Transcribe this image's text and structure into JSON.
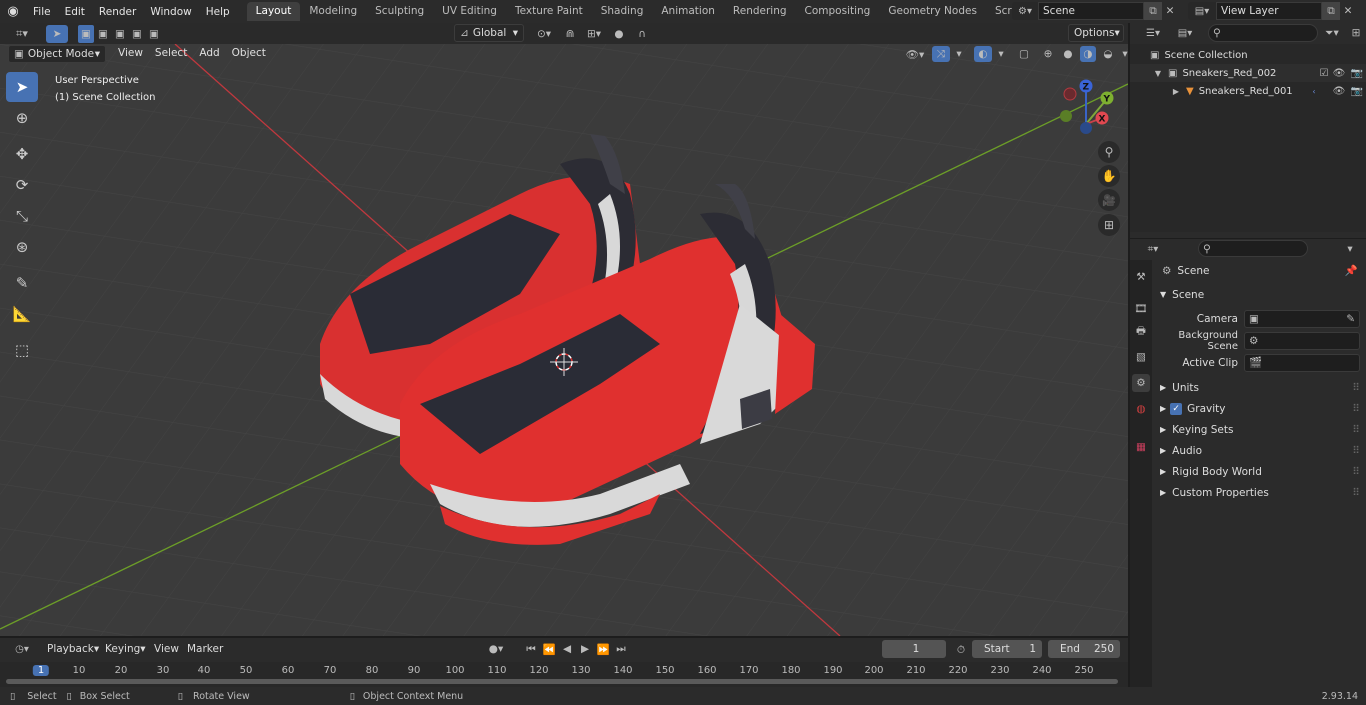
{
  "menu": [
    "File",
    "Edit",
    "Render",
    "Window",
    "Help"
  ],
  "workspaces": [
    "Layout",
    "Modeling",
    "Sculpting",
    "UV Editing",
    "Texture Paint",
    "Shading",
    "Animation",
    "Rendering",
    "Compositing",
    "Geometry Nodes",
    "Scripting"
  ],
  "scene_name": "Scene",
  "view_layer": "View Layer",
  "viewport_header": {
    "mode": "Object Mode",
    "menus": [
      "View",
      "Select",
      "Add",
      "Object"
    ],
    "orientation": "Global",
    "options": "Options"
  },
  "viewport_info": {
    "perspective": "User Perspective",
    "collection": "(1) Scene Collection"
  },
  "gizmo": {
    "z": "Z",
    "y": "Y",
    "x": "X"
  },
  "outliner": {
    "root": "Scene Collection",
    "collection": "Sneakers_Red_002",
    "object": "Sneakers_Red_001"
  },
  "properties": {
    "context": "Scene",
    "panel": "Scene",
    "camera_label": "Camera",
    "background_scene_label": "Background Scene",
    "active_clip_label": "Active Clip",
    "sections": [
      "Units",
      "Gravity",
      "Keying Sets",
      "Audio",
      "Rigid Body World",
      "Custom Properties"
    ]
  },
  "timeline": {
    "menus": [
      "Playback",
      "Keying",
      "View",
      "Marker"
    ],
    "current_frame": "1",
    "start_label": "Start",
    "start_value": "1",
    "end_label": "End",
    "end_value": "250",
    "ruler": [
      "1",
      "10",
      "20",
      "30",
      "40",
      "50",
      "60",
      "70",
      "80",
      "90",
      "100",
      "110",
      "120",
      "130",
      "140",
      "150",
      "160",
      "170",
      "180",
      "190",
      "200",
      "210",
      "220",
      "230",
      "240",
      "250"
    ]
  },
  "status": {
    "select": "Select",
    "box_select": "Box Select",
    "rotate": "Rotate View",
    "context_menu": "Object Context Menu",
    "version": "2.93.14"
  },
  "colors": {
    "accent": "#4772b3",
    "shoe_red": "#e0302f",
    "x_axis": "#d9474f",
    "y_axis": "#80b030"
  }
}
